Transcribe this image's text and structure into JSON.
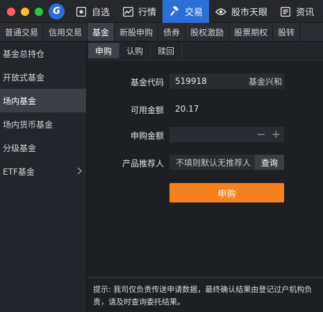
{
  "topnav": {
    "items": [
      {
        "label": "自选",
        "icon": "star-square-icon"
      },
      {
        "label": "行情",
        "icon": "chart-line-icon"
      },
      {
        "label": "交易",
        "icon": "hammer-icon",
        "active": true
      },
      {
        "label": "股市天眼",
        "icon": "eye-icon"
      },
      {
        "label": "资讯",
        "icon": "news-icon"
      }
    ]
  },
  "subtabs": {
    "items": [
      "普通交易",
      "信用交易",
      "基金",
      "新股申购",
      "债券",
      "股权激励",
      "股票期权",
      "股转"
    ],
    "active": "基金"
  },
  "sidebar": {
    "items": [
      "基金总持仓",
      "开放式基金",
      "场内基金",
      "场内货币基金",
      "分级基金",
      "ETF基金"
    ],
    "active": "场内基金"
  },
  "innertabs": {
    "items": [
      "申购",
      "认购",
      "赎回"
    ],
    "active": "申购"
  },
  "form": {
    "fund_code_label": "基金代码",
    "fund_code_value": "519918",
    "fund_name": "基金兴和",
    "available_label": "可用金额",
    "available_value": "20.17",
    "amount_label": "申购金额",
    "amount_value": "",
    "minus": "−",
    "plus": "+",
    "referrer_label": "产品推荐人",
    "referrer_placeholder": "不填则默认无推荐人",
    "query_label": "查询",
    "submit_label": "申购"
  },
  "notice": "提示: 我司仅负责传送申请数据，最终确认结果由登记过户机构负责，请及时查询委托结果。",
  "colors": {
    "accent": "#2c6fd7",
    "submit": "#f5821f"
  }
}
